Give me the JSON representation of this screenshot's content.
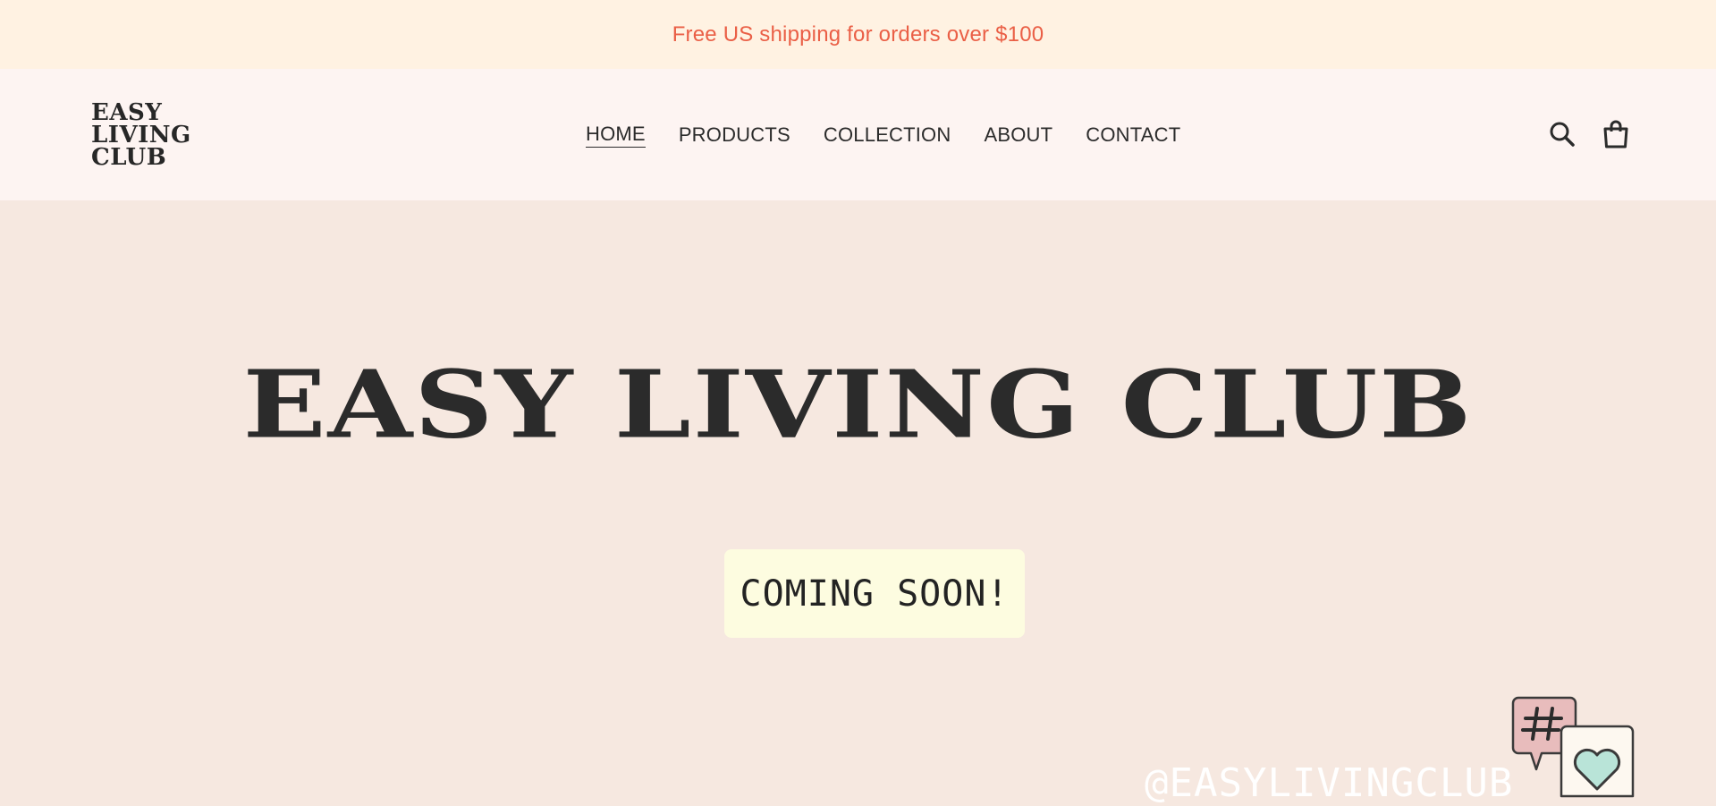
{
  "announcement": {
    "text": "Free US shipping for orders over $100"
  },
  "logo": {
    "lines": [
      "EASY",
      "LIVING",
      "CLUB"
    ]
  },
  "nav": {
    "items": [
      {
        "label": "HOME",
        "active": true
      },
      {
        "label": "PRODUCTS",
        "active": false
      },
      {
        "label": "COLLECTION",
        "active": false
      },
      {
        "label": "ABOUT",
        "active": false
      },
      {
        "label": "CONTACT",
        "active": false
      }
    ]
  },
  "header_icons": {
    "search": "search-icon",
    "cart": "shopping-bag-icon"
  },
  "hero": {
    "title": "EASY LIVING CLUB",
    "badge": "COMING SOON!",
    "social_handle": "@EASYLIVINGCLUB",
    "art_icons": [
      "hashtag-speech-bubble-icon",
      "heart-speech-bubble-icon"
    ]
  },
  "colors": {
    "announcement_bg": "#fff2e2",
    "announcement_text": "#ea5f46",
    "header_bg": "#fdf4f2",
    "hero_bg": "#f6e8e0",
    "badge_bg": "#fdfce0",
    "text_dark": "#2b2b2b",
    "bubble_pink": "#e8bcbc",
    "heart_mint": "#b9e4d8"
  }
}
